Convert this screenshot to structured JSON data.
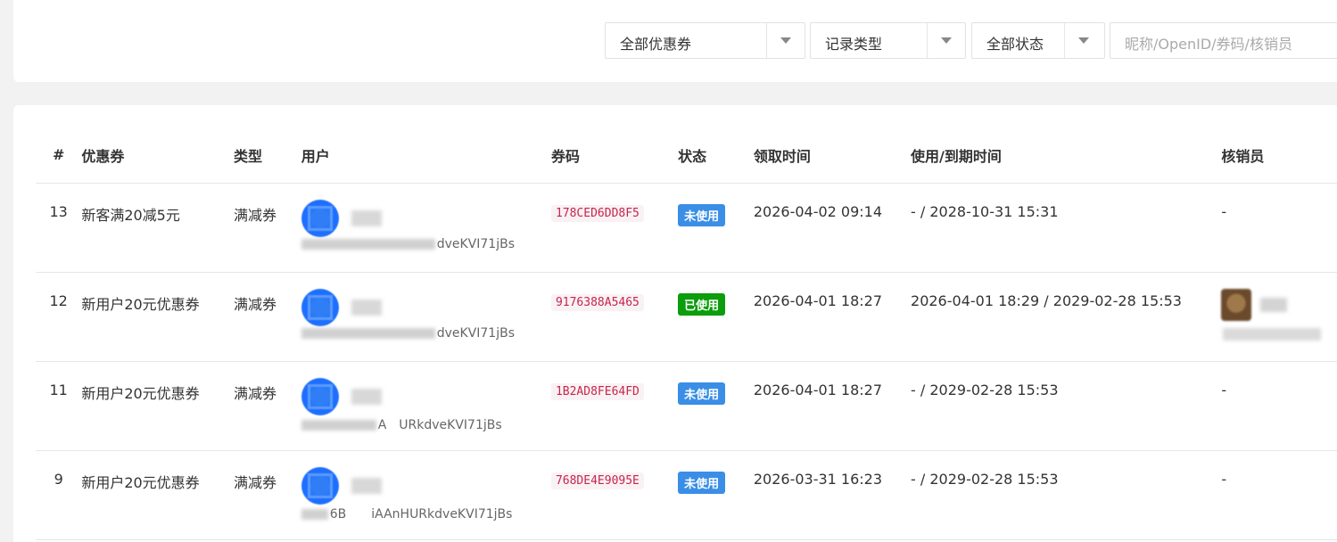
{
  "filters": {
    "coupon_select": "全部优惠券",
    "record_type_select": "记录类型",
    "status_select": "全部状态",
    "search_placeholder": "昵称/OpenID/券码/核销员"
  },
  "table": {
    "headers": {
      "id": "#",
      "coupon": "优惠券",
      "type": "类型",
      "user": "用户",
      "code": "券码",
      "status": "状态",
      "claim_time": "领取时间",
      "use_expire_time": "使用/到期时间",
      "verifier": "核销员"
    },
    "rows": [
      {
        "id": "13",
        "coupon": "新客满20减5元",
        "type": "满减券",
        "openid_tail": "dveKVI71jBs",
        "code": "178CED6DD8F5",
        "status": "未使用",
        "status_color": "#3a8ee6",
        "claim_time": "2026-04-02 09:14",
        "use_expire_time": "- / 2028-10-31 15:31",
        "verifier": "-"
      },
      {
        "id": "12",
        "coupon": "新用户20元优惠券",
        "type": "满减券",
        "openid_tail": "dveKVI71jBs",
        "code": "9176388A5465",
        "status": "已使用",
        "status_color": "#0b9d0b",
        "claim_time": "2026-04-01 18:27",
        "use_expire_time": "2026-04-01 18:29 / 2029-02-28 15:53",
        "verifier": ""
      },
      {
        "id": "11",
        "coupon": "新用户20元优惠券",
        "type": "满减券",
        "openid_tail": "A　URkdveKVI71jBs",
        "code": "1B2AD8FE64FD",
        "status": "未使用",
        "status_color": "#3a8ee6",
        "claim_time": "2026-04-01 18:27",
        "use_expire_time": "- / 2029-02-28 15:53",
        "verifier": "-"
      },
      {
        "id": "9",
        "coupon": "新用户20元优惠券",
        "type": "满减券",
        "openid_tail": "6B　　iAAnHURkdveKVI71jBs",
        "code": "768DE4E9095E",
        "status": "未使用",
        "status_color": "#3a8ee6",
        "claim_time": "2026-03-31 16:23",
        "use_expire_time": "- / 2029-02-28 15:53",
        "verifier": "-"
      }
    ]
  }
}
